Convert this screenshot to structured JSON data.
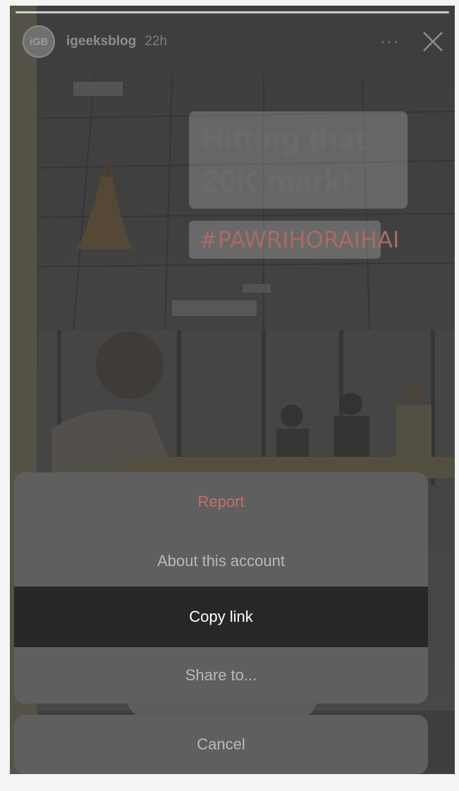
{
  "story": {
    "avatar_text": "iGB",
    "username": "igeeksblog",
    "time": "22h",
    "more_icon": "more-dots-icon",
    "close_icon": "close-icon",
    "sticker_line1": "Hitting that",
    "sticker_line2": "20K mark!",
    "hashtag": "#PAWRIHORAIHAI"
  },
  "action_sheet": {
    "report_label": "Report",
    "about_label": "About this account",
    "copy_label": "Copy link",
    "share_label": "Share to...",
    "cancel_label": "Cancel",
    "colors": {
      "destructive": "#c66e6a",
      "highlight_bg": "#272727",
      "sheet_bg": "#5f5f5f"
    }
  }
}
